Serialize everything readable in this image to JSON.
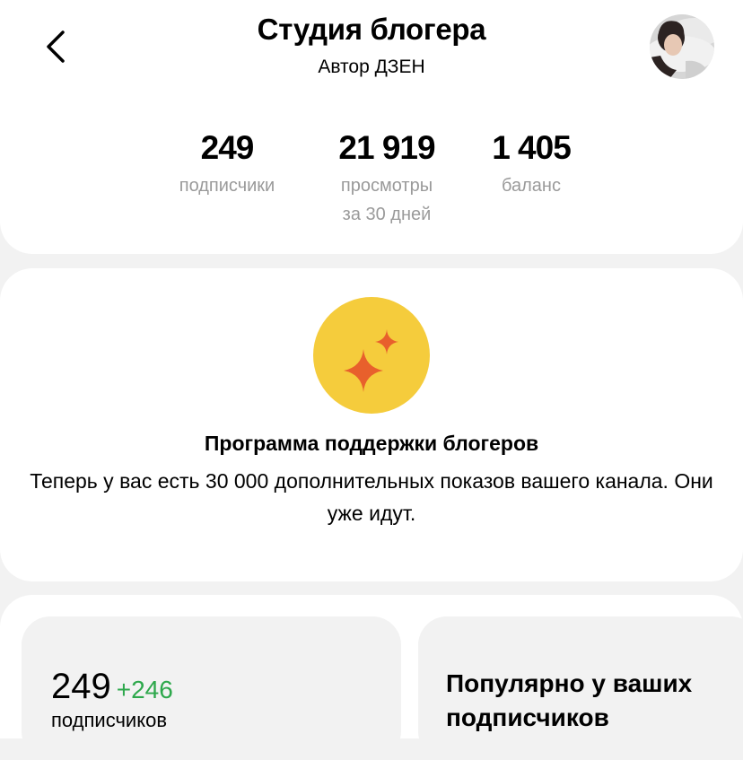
{
  "header": {
    "title": "Студия блогера",
    "subtitle": "Автор ДЗЕН",
    "back_icon": "chevron-left-icon",
    "avatar_icon": "user-avatar"
  },
  "stats": [
    {
      "value": "249",
      "label": "подписчики"
    },
    {
      "value": "21 919",
      "label": "просмотры\nза 30 дней"
    },
    {
      "value": "1 405",
      "label": "баланс"
    }
  ],
  "program": {
    "icon": "sparkles-icon",
    "icon_colors": {
      "circle": "#f5cc3c",
      "sparkle": "#e8602c"
    },
    "title": "Программа поддержки блогеров",
    "description": "Теперь у вас есть 30 000 дополнительных показов вашего канала. Они уже идут."
  },
  "tiles": {
    "subscribers": {
      "count": "249",
      "delta": "+246",
      "delta_color": "#2ea84c",
      "label": "подписчиков"
    },
    "popular": {
      "title": "Популярно у ваших подписчиков"
    }
  }
}
